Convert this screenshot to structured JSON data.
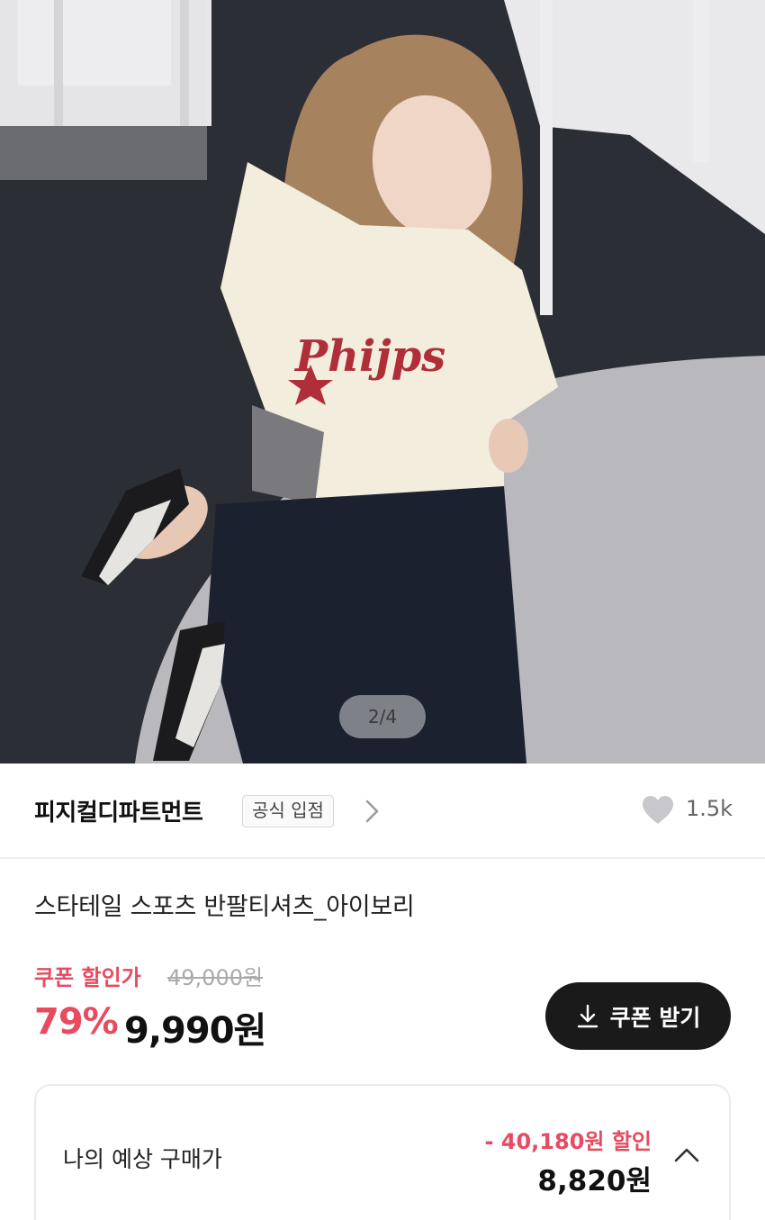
{
  "gallery": {
    "counter": "2/4",
    "shirt_print": "Phijps"
  },
  "seller": {
    "name": "피지컬디파트먼트",
    "badge": "공식 입점",
    "chevron_icon": "chevron-right-icon",
    "like_icon": "heart-icon",
    "like_count": "1.5k"
  },
  "product": {
    "title": "스타테일 스포츠 반팔티셔츠_아이보리"
  },
  "price": {
    "coupon_label": "쿠폰 할인가",
    "original": "49,000원",
    "discount_rate": "79%",
    "sale": "9,990원",
    "coupon_button_label": "쿠폰 받기",
    "coupon_button_icon": "download-icon"
  },
  "expected": {
    "label": "나의 예상 구매가",
    "discount": "- 40,180원 할인",
    "price": "8,820원",
    "toggle_icon": "chevron-up-icon"
  },
  "colors": {
    "accent": "#e84a5f",
    "button_bg": "#1a1a1a"
  }
}
